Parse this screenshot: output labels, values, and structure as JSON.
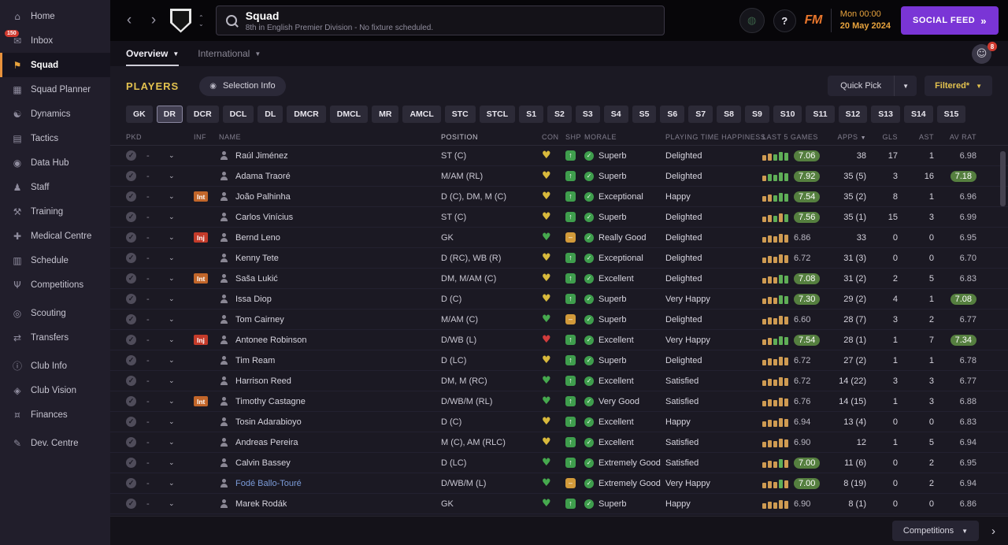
{
  "sidebar": {
    "items": [
      {
        "label": "Home",
        "icon": "home"
      },
      {
        "label": "Inbox",
        "icon": "inbox",
        "badge": "150"
      },
      {
        "label": "Squad",
        "icon": "squad",
        "active": true
      },
      {
        "label": "Squad Planner",
        "icon": "squad-planner"
      },
      {
        "label": "Dynamics",
        "icon": "dynamics"
      },
      {
        "label": "Tactics",
        "icon": "tactics"
      },
      {
        "label": "Data Hub",
        "icon": "data-hub"
      },
      {
        "label": "Staff",
        "icon": "staff"
      },
      {
        "label": "Training",
        "icon": "training"
      },
      {
        "label": "Medical Centre",
        "icon": "medical-centre"
      },
      {
        "label": "Schedule",
        "icon": "schedule"
      },
      {
        "label": "Competitions",
        "icon": "competitions"
      },
      {
        "label": "Scouting",
        "icon": "scouting",
        "gap": true
      },
      {
        "label": "Transfers",
        "icon": "transfers"
      },
      {
        "label": "Club Info",
        "icon": "club-info",
        "gap": true
      },
      {
        "label": "Club Vision",
        "icon": "club-vision"
      },
      {
        "label": "Finances",
        "icon": "finances"
      },
      {
        "label": "Dev. Centre",
        "icon": "dev-centre",
        "gap": true
      }
    ]
  },
  "topbar": {
    "title": "Squad",
    "subtitle": "8th in English Premier Division - No fixture scheduled.",
    "help": "?",
    "fm_logo": "FM",
    "date_line1": "Mon 00:00",
    "date_line2": "20 May 2024",
    "social_feed": "SOCIAL FEED",
    "social_arrows": "»"
  },
  "tabs": {
    "overview": "Overview",
    "international": "International",
    "avatar_badge": "8"
  },
  "toolbar": {
    "players": "PLAYERS",
    "selection_info": "Selection Info",
    "quick_pick": "Quick Pick",
    "filtered": "Filtered*"
  },
  "filters": {
    "active": "DR",
    "buttons": [
      "GK",
      "DR",
      "DCR",
      "DCL",
      "DL",
      "DMCR",
      "DMCL",
      "MR",
      "AMCL",
      "STC",
      "STCL",
      "S1",
      "S2",
      "S3",
      "S4",
      "S5",
      "S6",
      "S7",
      "S8",
      "S9",
      "S10",
      "S11",
      "S12",
      "S13",
      "S14",
      "S15"
    ]
  },
  "table": {
    "dash": "-",
    "columns": [
      "PKD",
      "INF",
      "NAME",
      "POSITION",
      "CON",
      "SHP",
      "MORALE",
      "PLAYING TIME HAPPINESS",
      "LAST 5 GAMES",
      "APPS",
      "GLS",
      "AST",
      "AV RAT"
    ],
    "rows": [
      {
        "name": "Raúl Jiménez",
        "pos": "ST (C)",
        "con": "yellow",
        "shp": "green",
        "morale": "Superb",
        "happiness": "Delighted",
        "bars": "ooggg",
        "last5": "7.06",
        "last5_badge": true,
        "apps": "38",
        "gls": "17",
        "ast": "1",
        "avrat": "6.98"
      },
      {
        "name": "Adama Traoré",
        "pos": "M/AM (RL)",
        "con": "yellow",
        "shp": "green",
        "morale": "Superb",
        "happiness": "Delighted",
        "bars": "ogggg",
        "last5": "7.92",
        "last5_badge": true,
        "apps": "35 (5)",
        "gls": "3",
        "ast": "16",
        "avrat": "7.18",
        "avrat_badge": true
      },
      {
        "name": "João Palhinha",
        "inf": "Int",
        "pos": "D (C), DM, M (C)",
        "con": "yellow",
        "shp": "green",
        "morale": "Exceptional",
        "happiness": "Happy",
        "bars": "ooggg",
        "last5": "7.54",
        "last5_badge": true,
        "apps": "35 (2)",
        "gls": "8",
        "ast": "1",
        "avrat": "6.96"
      },
      {
        "name": "Carlos Vinícius",
        "pos": "ST (C)",
        "con": "yellow",
        "shp": "green",
        "morale": "Superb",
        "happiness": "Delighted",
        "bars": "oogog",
        "last5": "7.56",
        "last5_badge": true,
        "apps": "35 (1)",
        "gls": "15",
        "ast": "3",
        "avrat": "6.99"
      },
      {
        "name": "Bernd Leno",
        "inf": "Inj",
        "pos": "GK",
        "con": "green",
        "shp": "amber",
        "morale": "Really Good",
        "happiness": "Delighted",
        "bars": "ooooo",
        "last5": "6.86",
        "apps": "33",
        "gls": "0",
        "ast": "0",
        "avrat": "6.95"
      },
      {
        "name": "Kenny Tete",
        "pos": "D (RC), WB (R)",
        "con": "yellow",
        "shp": "green",
        "morale": "Exceptional",
        "happiness": "Delighted",
        "bars": "ooooo",
        "last5": "6.72",
        "apps": "31 (3)",
        "gls": "0",
        "ast": "0",
        "avrat": "6.70"
      },
      {
        "name": "Saša Lukić",
        "inf": "Int",
        "pos": "DM, M/AM (C)",
        "con": "yellow",
        "shp": "green",
        "morale": "Excellent",
        "happiness": "Delighted",
        "bars": "ooogg",
        "last5": "7.08",
        "last5_badge": true,
        "apps": "31 (2)",
        "gls": "2",
        "ast": "5",
        "avrat": "6.83"
      },
      {
        "name": "Issa Diop",
        "pos": "D (C)",
        "con": "yellow",
        "shp": "green",
        "morale": "Superb",
        "happiness": "Very Happy",
        "bars": "ooogg",
        "last5": "7.30",
        "last5_badge": true,
        "apps": "29 (2)",
        "gls": "4",
        "ast": "1",
        "avrat": "7.08",
        "avrat_badge": true
      },
      {
        "name": "Tom Cairney",
        "pos": "M/AM (C)",
        "con": "green",
        "shp": "amber",
        "morale": "Superb",
        "happiness": "Delighted",
        "bars": "ooooo",
        "last5": "6.60",
        "apps": "28 (7)",
        "gls": "3",
        "ast": "2",
        "avrat": "6.77"
      },
      {
        "name": "Antonee Robinson",
        "inf": "Inj",
        "pos": "D/WB (L)",
        "con": "red",
        "shp": "green",
        "morale": "Excellent",
        "happiness": "Very Happy",
        "bars": "ooggg",
        "last5": "7.54",
        "last5_badge": true,
        "apps": "28 (1)",
        "gls": "1",
        "ast": "7",
        "avrat": "7.34",
        "avrat_badge": true
      },
      {
        "name": "Tim Ream",
        "pos": "D (LC)",
        "con": "yellow",
        "shp": "green",
        "morale": "Superb",
        "happiness": "Delighted",
        "bars": "ooooo",
        "last5": "6.72",
        "apps": "27 (2)",
        "gls": "1",
        "ast": "1",
        "avrat": "6.78"
      },
      {
        "name": "Harrison Reed",
        "pos": "DM, M (RC)",
        "con": "green",
        "shp": "green",
        "morale": "Excellent",
        "happiness": "Satisfied",
        "bars": "ooooo",
        "last5": "6.72",
        "apps": "14 (22)",
        "gls": "3",
        "ast": "3",
        "avrat": "6.77"
      },
      {
        "name": "Timothy Castagne",
        "inf": "Int",
        "pos": "D/WB/M (RL)",
        "con": "green",
        "shp": "green",
        "morale": "Very Good",
        "happiness": "Satisfied",
        "bars": "ooooo",
        "last5": "6.76",
        "apps": "14 (15)",
        "gls": "1",
        "ast": "3",
        "avrat": "6.88"
      },
      {
        "name": "Tosin Adarabioyo",
        "pos": "D (C)",
        "con": "yellow",
        "shp": "green",
        "morale": "Excellent",
        "happiness": "Happy",
        "bars": "ooooo",
        "last5": "6.94",
        "apps": "13 (4)",
        "gls": "0",
        "ast": "0",
        "avrat": "6.83"
      },
      {
        "name": "Andreas Pereira",
        "pos": "M (C), AM (RLC)",
        "con": "yellow",
        "shp": "green",
        "morale": "Excellent",
        "happiness": "Satisfied",
        "bars": "ooooo",
        "last5": "6.90",
        "apps": "12",
        "gls": "1",
        "ast": "5",
        "avrat": "6.94"
      },
      {
        "name": "Calvin Bassey",
        "pos": "D (LC)",
        "con": "green",
        "shp": "green",
        "morale": "Extremely Good",
        "happiness": "Satisfied",
        "bars": "ooogo",
        "last5": "7.00",
        "last5_badge": true,
        "apps": "11 (6)",
        "gls": "0",
        "ast": "2",
        "avrat": "6.95"
      },
      {
        "name": "Fodé Ballo-Touré",
        "link": true,
        "pos": "D/WB/M (L)",
        "con": "green",
        "shp": "amber",
        "morale": "Extremely Good",
        "happiness": "Very Happy",
        "bars": "ooogo",
        "last5": "7.00",
        "last5_badge": true,
        "apps": "8 (19)",
        "gls": "0",
        "ast": "2",
        "avrat": "6.94"
      },
      {
        "name": "Marek Rodák",
        "pos": "GK",
        "con": "green",
        "shp": "green",
        "morale": "Superb",
        "happiness": "Happy",
        "bars": "ooooo",
        "last5": "6.90",
        "apps": "8 (1)",
        "gls": "0",
        "ast": "0",
        "avrat": "6.86"
      }
    ]
  },
  "footer": {
    "competitions": "Competitions"
  },
  "colors": {
    "accent_gold": "#e3c24f",
    "accent_orange": "#e8923c",
    "social_purple": "#7a35d6",
    "rating_badge_green": "#557f3f",
    "condition_yellow": "#d8b93c",
    "condition_green": "#46a94e",
    "condition_red": "#d23c3c"
  }
}
